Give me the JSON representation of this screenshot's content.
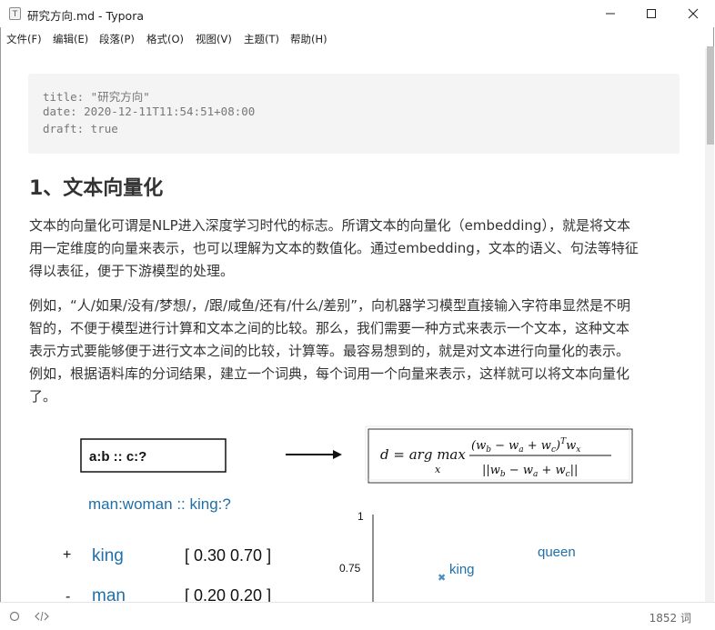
{
  "window": {
    "title": "研究方向.md - Typora",
    "app_icon_letter": "T"
  },
  "menu": {
    "items": [
      "文件(F)",
      "编辑(E)",
      "段落(P)",
      "格式(O)",
      "视图(V)",
      "主题(T)",
      "帮助(H)"
    ]
  },
  "front_matter": {
    "lines": [
      "title: \"研究方向\"",
      "date: 2020-12-11T11:54:51+08:00",
      "draft: true"
    ]
  },
  "content": {
    "heading": "1、文本向量化",
    "para1": [
      "文本的向量化可谓是NLP进入深度学习时代的标志。所谓文本的向量化（embedding），就是将文本",
      "用一定维度的向量来表示，也可以理解为文本的数值化。通过embedding，文本的语义、句法等特征",
      "得以表征，便于下游模型的处理。"
    ],
    "para2": [
      "例如，“人/如果/没有/梦想/，/跟/咸鱼/还有/什么/差别”，向机器学习模型直接输入字符串显然是不明",
      "智的，不便于模型进行计算和文本之间的比较。那么，我们需要一种方式来表示一个文本，这种文本",
      "表示方式要能够便于进行文本之间的比较，计算等。最容易想到的，就是对文本进行向量化的表示。",
      "例如，根据语料库的分词结果，建立一个词典，每个词用一个向量来表示，这样就可以将文本向量化",
      "了。"
    ]
  },
  "figure": {
    "analogy_box": "a:b :: c:?",
    "formula_lhs": "d = arg max",
    "formula_sub": "x",
    "formula_num": "(w",
    "example_title": "man:woman :: king:?",
    "rows": [
      {
        "sign": "+",
        "word": "king",
        "vector": "[ 0.30 0.70 ]"
      },
      {
        "sign": "-",
        "word": "man",
        "vector": "[ 0.20 0.20 ]"
      }
    ],
    "axis_ticks": [
      "1",
      "0.75"
    ],
    "point_labels": [
      "king",
      "queen"
    ],
    "colors": {
      "word": "#1f6fa8",
      "point": "#4a8fc0"
    }
  },
  "status": {
    "word_count": "1852 词"
  }
}
